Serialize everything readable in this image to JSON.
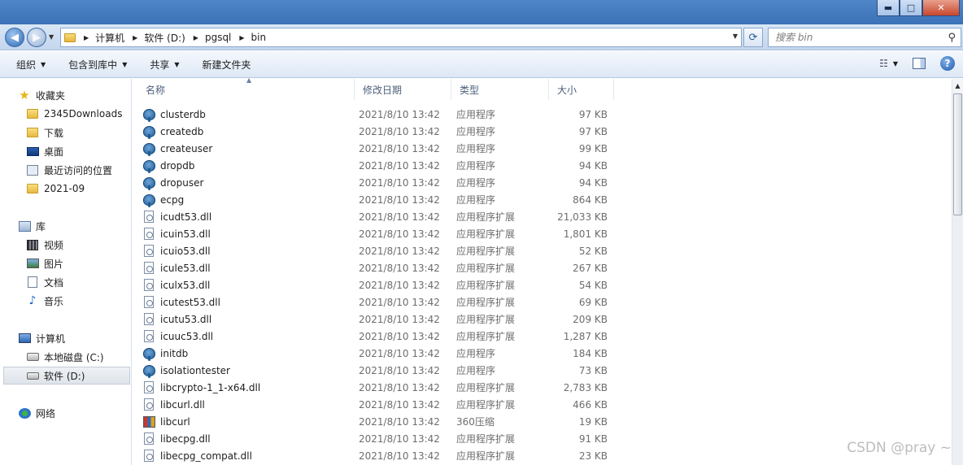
{
  "window": {
    "controls": {
      "minimize": "▬",
      "maximize": "□",
      "close": "✕"
    }
  },
  "address": {
    "breadcrumbs": [
      "计算机",
      "软件 (D:)",
      "pgsql",
      "bin"
    ],
    "search_placeholder": "搜索 bin"
  },
  "toolbar": {
    "organize": "组织",
    "include_library": "包含到库中",
    "share": "共享",
    "new_folder": "新建文件夹"
  },
  "navpane": {
    "favorites": "收藏夹",
    "favorites_items": [
      "2345Downloads",
      "下载",
      "桌面",
      "最近访问的位置",
      "2021-09"
    ],
    "libraries": "库",
    "libraries_items": [
      "视频",
      "图片",
      "文档",
      "音乐"
    ],
    "computer": "计算机",
    "computer_items": [
      "本地磁盘 (C:)",
      "软件 (D:)"
    ],
    "network": "网络",
    "selected": "软件 (D:)"
  },
  "columns": {
    "name": "名称",
    "date": "修改日期",
    "type": "类型",
    "size": "大小"
  },
  "files": [
    {
      "name": "clusterdb",
      "date": "2021/8/10 13:42",
      "type": "应用程序",
      "size": "97 KB",
      "icon": "elephant-icon"
    },
    {
      "name": "createdb",
      "date": "2021/8/10 13:42",
      "type": "应用程序",
      "size": "97 KB",
      "icon": "elephant-icon"
    },
    {
      "name": "createuser",
      "date": "2021/8/10 13:42",
      "type": "应用程序",
      "size": "99 KB",
      "icon": "elephant-icon"
    },
    {
      "name": "dropdb",
      "date": "2021/8/10 13:42",
      "type": "应用程序",
      "size": "94 KB",
      "icon": "elephant-icon"
    },
    {
      "name": "dropuser",
      "date": "2021/8/10 13:42",
      "type": "应用程序",
      "size": "94 KB",
      "icon": "elephant-icon"
    },
    {
      "name": "ecpg",
      "date": "2021/8/10 13:42",
      "type": "应用程序",
      "size": "864 KB",
      "icon": "elephant-icon"
    },
    {
      "name": "icudt53.dll",
      "date": "2021/8/10 13:42",
      "type": "应用程序扩展",
      "size": "21,033 KB",
      "icon": "dll-icon"
    },
    {
      "name": "icuin53.dll",
      "date": "2021/8/10 13:42",
      "type": "应用程序扩展",
      "size": "1,801 KB",
      "icon": "dll-icon"
    },
    {
      "name": "icuio53.dll",
      "date": "2021/8/10 13:42",
      "type": "应用程序扩展",
      "size": "52 KB",
      "icon": "dll-icon"
    },
    {
      "name": "icule53.dll",
      "date": "2021/8/10 13:42",
      "type": "应用程序扩展",
      "size": "267 KB",
      "icon": "dll-icon"
    },
    {
      "name": "iculx53.dll",
      "date": "2021/8/10 13:42",
      "type": "应用程序扩展",
      "size": "54 KB",
      "icon": "dll-icon"
    },
    {
      "name": "icutest53.dll",
      "date": "2021/8/10 13:42",
      "type": "应用程序扩展",
      "size": "69 KB",
      "icon": "dll-icon"
    },
    {
      "name": "icutu53.dll",
      "date": "2021/8/10 13:42",
      "type": "应用程序扩展",
      "size": "209 KB",
      "icon": "dll-icon"
    },
    {
      "name": "icuuc53.dll",
      "date": "2021/8/10 13:42",
      "type": "应用程序扩展",
      "size": "1,287 KB",
      "icon": "dll-icon"
    },
    {
      "name": "initdb",
      "date": "2021/8/10 13:42",
      "type": "应用程序",
      "size": "184 KB",
      "icon": "elephant-icon"
    },
    {
      "name": "isolationtester",
      "date": "2021/8/10 13:42",
      "type": "应用程序",
      "size": "73 KB",
      "icon": "elephant-icon"
    },
    {
      "name": "libcrypto-1_1-x64.dll",
      "date": "2021/8/10 13:42",
      "type": "应用程序扩展",
      "size": "2,783 KB",
      "icon": "dll-icon"
    },
    {
      "name": "libcurl.dll",
      "date": "2021/8/10 13:42",
      "type": "应用程序扩展",
      "size": "466 KB",
      "icon": "dll-icon"
    },
    {
      "name": "libcurl",
      "date": "2021/8/10 13:42",
      "type": "360压缩",
      "size": "19 KB",
      "icon": "archive-icon"
    },
    {
      "name": "libecpg.dll",
      "date": "2021/8/10 13:42",
      "type": "应用程序扩展",
      "size": "91 KB",
      "icon": "dll-icon"
    },
    {
      "name": "libecpg_compat.dll",
      "date": "2021/8/10 13:42",
      "type": "应用程序扩展",
      "size": "23 KB",
      "icon": "dll-icon"
    }
  ],
  "watermark": "CSDN @pray ~"
}
